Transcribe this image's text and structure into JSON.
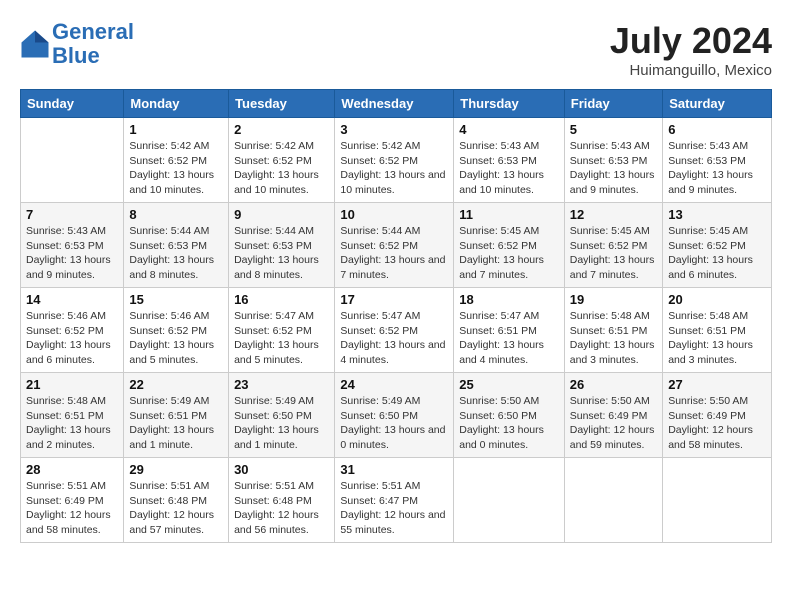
{
  "header": {
    "logo_line1": "General",
    "logo_line2": "Blue",
    "month": "July 2024",
    "location": "Huimanguillo, Mexico"
  },
  "columns": [
    "Sunday",
    "Monday",
    "Tuesday",
    "Wednesday",
    "Thursday",
    "Friday",
    "Saturday"
  ],
  "weeks": [
    [
      {
        "day": "",
        "sunrise": "",
        "sunset": "",
        "daylight": ""
      },
      {
        "day": "1",
        "sunrise": "Sunrise: 5:42 AM",
        "sunset": "Sunset: 6:52 PM",
        "daylight": "Daylight: 13 hours and 10 minutes."
      },
      {
        "day": "2",
        "sunrise": "Sunrise: 5:42 AM",
        "sunset": "Sunset: 6:52 PM",
        "daylight": "Daylight: 13 hours and 10 minutes."
      },
      {
        "day": "3",
        "sunrise": "Sunrise: 5:42 AM",
        "sunset": "Sunset: 6:52 PM",
        "daylight": "Daylight: 13 hours and 10 minutes."
      },
      {
        "day": "4",
        "sunrise": "Sunrise: 5:43 AM",
        "sunset": "Sunset: 6:53 PM",
        "daylight": "Daylight: 13 hours and 10 minutes."
      },
      {
        "day": "5",
        "sunrise": "Sunrise: 5:43 AM",
        "sunset": "Sunset: 6:53 PM",
        "daylight": "Daylight: 13 hours and 9 minutes."
      },
      {
        "day": "6",
        "sunrise": "Sunrise: 5:43 AM",
        "sunset": "Sunset: 6:53 PM",
        "daylight": "Daylight: 13 hours and 9 minutes."
      }
    ],
    [
      {
        "day": "7",
        "sunrise": "Sunrise: 5:43 AM",
        "sunset": "Sunset: 6:53 PM",
        "daylight": "Daylight: 13 hours and 9 minutes."
      },
      {
        "day": "8",
        "sunrise": "Sunrise: 5:44 AM",
        "sunset": "Sunset: 6:53 PM",
        "daylight": "Daylight: 13 hours and 8 minutes."
      },
      {
        "day": "9",
        "sunrise": "Sunrise: 5:44 AM",
        "sunset": "Sunset: 6:53 PM",
        "daylight": "Daylight: 13 hours and 8 minutes."
      },
      {
        "day": "10",
        "sunrise": "Sunrise: 5:44 AM",
        "sunset": "Sunset: 6:52 PM",
        "daylight": "Daylight: 13 hours and 7 minutes."
      },
      {
        "day": "11",
        "sunrise": "Sunrise: 5:45 AM",
        "sunset": "Sunset: 6:52 PM",
        "daylight": "Daylight: 13 hours and 7 minutes."
      },
      {
        "day": "12",
        "sunrise": "Sunrise: 5:45 AM",
        "sunset": "Sunset: 6:52 PM",
        "daylight": "Daylight: 13 hours and 7 minutes."
      },
      {
        "day": "13",
        "sunrise": "Sunrise: 5:45 AM",
        "sunset": "Sunset: 6:52 PM",
        "daylight": "Daylight: 13 hours and 6 minutes."
      }
    ],
    [
      {
        "day": "14",
        "sunrise": "Sunrise: 5:46 AM",
        "sunset": "Sunset: 6:52 PM",
        "daylight": "Daylight: 13 hours and 6 minutes."
      },
      {
        "day": "15",
        "sunrise": "Sunrise: 5:46 AM",
        "sunset": "Sunset: 6:52 PM",
        "daylight": "Daylight: 13 hours and 5 minutes."
      },
      {
        "day": "16",
        "sunrise": "Sunrise: 5:47 AM",
        "sunset": "Sunset: 6:52 PM",
        "daylight": "Daylight: 13 hours and 5 minutes."
      },
      {
        "day": "17",
        "sunrise": "Sunrise: 5:47 AM",
        "sunset": "Sunset: 6:52 PM",
        "daylight": "Daylight: 13 hours and 4 minutes."
      },
      {
        "day": "18",
        "sunrise": "Sunrise: 5:47 AM",
        "sunset": "Sunset: 6:51 PM",
        "daylight": "Daylight: 13 hours and 4 minutes."
      },
      {
        "day": "19",
        "sunrise": "Sunrise: 5:48 AM",
        "sunset": "Sunset: 6:51 PM",
        "daylight": "Daylight: 13 hours and 3 minutes."
      },
      {
        "day": "20",
        "sunrise": "Sunrise: 5:48 AM",
        "sunset": "Sunset: 6:51 PM",
        "daylight": "Daylight: 13 hours and 3 minutes."
      }
    ],
    [
      {
        "day": "21",
        "sunrise": "Sunrise: 5:48 AM",
        "sunset": "Sunset: 6:51 PM",
        "daylight": "Daylight: 13 hours and 2 minutes."
      },
      {
        "day": "22",
        "sunrise": "Sunrise: 5:49 AM",
        "sunset": "Sunset: 6:51 PM",
        "daylight": "Daylight: 13 hours and 1 minute."
      },
      {
        "day": "23",
        "sunrise": "Sunrise: 5:49 AM",
        "sunset": "Sunset: 6:50 PM",
        "daylight": "Daylight: 13 hours and 1 minute."
      },
      {
        "day": "24",
        "sunrise": "Sunrise: 5:49 AM",
        "sunset": "Sunset: 6:50 PM",
        "daylight": "Daylight: 13 hours and 0 minutes."
      },
      {
        "day": "25",
        "sunrise": "Sunrise: 5:50 AM",
        "sunset": "Sunset: 6:50 PM",
        "daylight": "Daylight: 13 hours and 0 minutes."
      },
      {
        "day": "26",
        "sunrise": "Sunrise: 5:50 AM",
        "sunset": "Sunset: 6:49 PM",
        "daylight": "Daylight: 12 hours and 59 minutes."
      },
      {
        "day": "27",
        "sunrise": "Sunrise: 5:50 AM",
        "sunset": "Sunset: 6:49 PM",
        "daylight": "Daylight: 12 hours and 58 minutes."
      }
    ],
    [
      {
        "day": "28",
        "sunrise": "Sunrise: 5:51 AM",
        "sunset": "Sunset: 6:49 PM",
        "daylight": "Daylight: 12 hours and 58 minutes."
      },
      {
        "day": "29",
        "sunrise": "Sunrise: 5:51 AM",
        "sunset": "Sunset: 6:48 PM",
        "daylight": "Daylight: 12 hours and 57 minutes."
      },
      {
        "day": "30",
        "sunrise": "Sunrise: 5:51 AM",
        "sunset": "Sunset: 6:48 PM",
        "daylight": "Daylight: 12 hours and 56 minutes."
      },
      {
        "day": "31",
        "sunrise": "Sunrise: 5:51 AM",
        "sunset": "Sunset: 6:47 PM",
        "daylight": "Daylight: 12 hours and 55 minutes."
      },
      {
        "day": "",
        "sunrise": "",
        "sunset": "",
        "daylight": ""
      },
      {
        "day": "",
        "sunrise": "",
        "sunset": "",
        "daylight": ""
      },
      {
        "day": "",
        "sunrise": "",
        "sunset": "",
        "daylight": ""
      }
    ]
  ]
}
